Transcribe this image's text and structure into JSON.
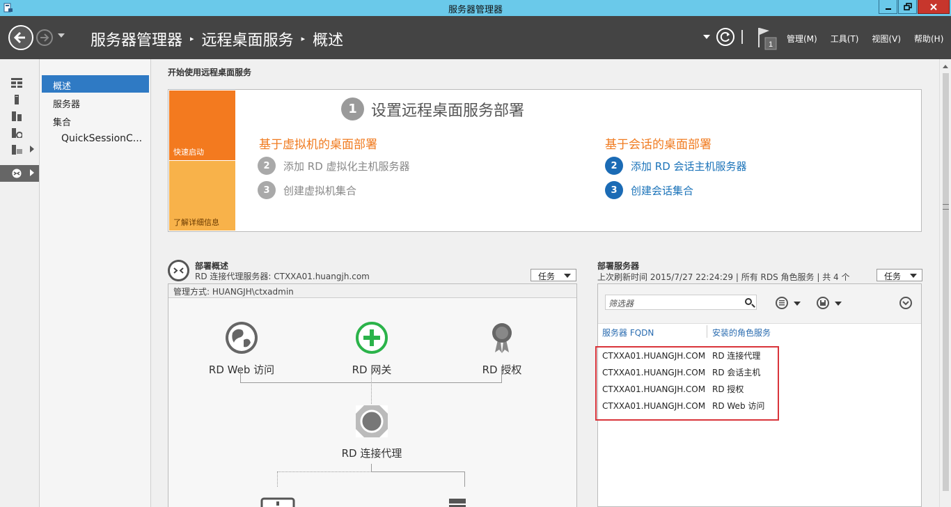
{
  "window": {
    "title": "服务器管理器",
    "controls": {
      "minimize": "—",
      "maximize": "□",
      "close": "✕"
    }
  },
  "header": {
    "breadcrumb": [
      "服务器管理器",
      "远程桌面服务",
      "概述"
    ],
    "menus": [
      "管理(M)",
      "工具(T)",
      "视图(V)",
      "帮助(H)"
    ],
    "flag_badge": "1"
  },
  "iconbar": {
    "items": [
      {
        "icon": "dashboard-icon"
      },
      {
        "icon": "local-server-icon"
      },
      {
        "icon": "all-servers-icon"
      },
      {
        "icon": "file-storage-icon"
      },
      {
        "icon": "file-services-icon"
      },
      {
        "icon": "remote-desktop-icon"
      }
    ]
  },
  "navpanel": {
    "items": [
      {
        "label": "概述",
        "active": true
      },
      {
        "label": "服务器",
        "active": false
      },
      {
        "label": "集合",
        "active": false
      },
      {
        "label": "QuickSessionC...",
        "active": false
      }
    ]
  },
  "start": {
    "section_title": "开始使用远程桌面服务",
    "quick_start": "快速启动",
    "learn_more": "了解详细信息",
    "step1_number": "1",
    "step1_label": "设置远程桌面服务部署",
    "vm": {
      "title": "基于虚拟机的桌面部署",
      "steps": [
        {
          "number": "2",
          "label": "添加 RD 虚拟化主机服务器"
        },
        {
          "number": "3",
          "label": "创建虚拟机集合"
        }
      ]
    },
    "session": {
      "title": "基于会话的桌面部署",
      "steps": [
        {
          "number": "2",
          "label": "添加 RD 会话主机服务器"
        },
        {
          "number": "3",
          "label": "创建会话集合"
        }
      ]
    }
  },
  "deployment": {
    "title": "部署概述",
    "broker_line": "RD 连接代理服务器: CTXXA01.huangjh.com",
    "tasks": "任务",
    "managed_by": "管理方式: HUANGJH\\ctxadmin",
    "nodes": {
      "web": "RD Web 访问",
      "gateway": "RD 网关",
      "license": "RD 授权",
      "broker": "RD 连接代理"
    }
  },
  "servers": {
    "title": "部署服务器",
    "refresh_line": "上次刷新时间 2015/7/27 22:24:29 | 所有 RDS 角色服务 | 共 4 个",
    "tasks": "任务",
    "filter_placeholder": "筛选器",
    "columns": [
      "服务器 FQDN",
      "安装的角色服务"
    ],
    "rows": [
      {
        "fqdn": "CTXXA01.HUANGJH.COM",
        "role": "RD 连接代理"
      },
      {
        "fqdn": "CTXXA01.HUANGJH.COM",
        "role": "RD 会话主机"
      },
      {
        "fqdn": "CTXXA01.HUANGJH.COM",
        "role": "RD 授权"
      },
      {
        "fqdn": "CTXXA01.HUANGJH.COM",
        "role": "RD Web 访问"
      }
    ]
  },
  "colors": {
    "title_bar": "#6ac9ea",
    "header": "#444444",
    "nav_active": "#2f7ac4",
    "quick_start": "#f37a1f",
    "learn_more": "#f8b24a",
    "link_blue": "#1b73b9",
    "highlight_red": "#d9343a"
  }
}
